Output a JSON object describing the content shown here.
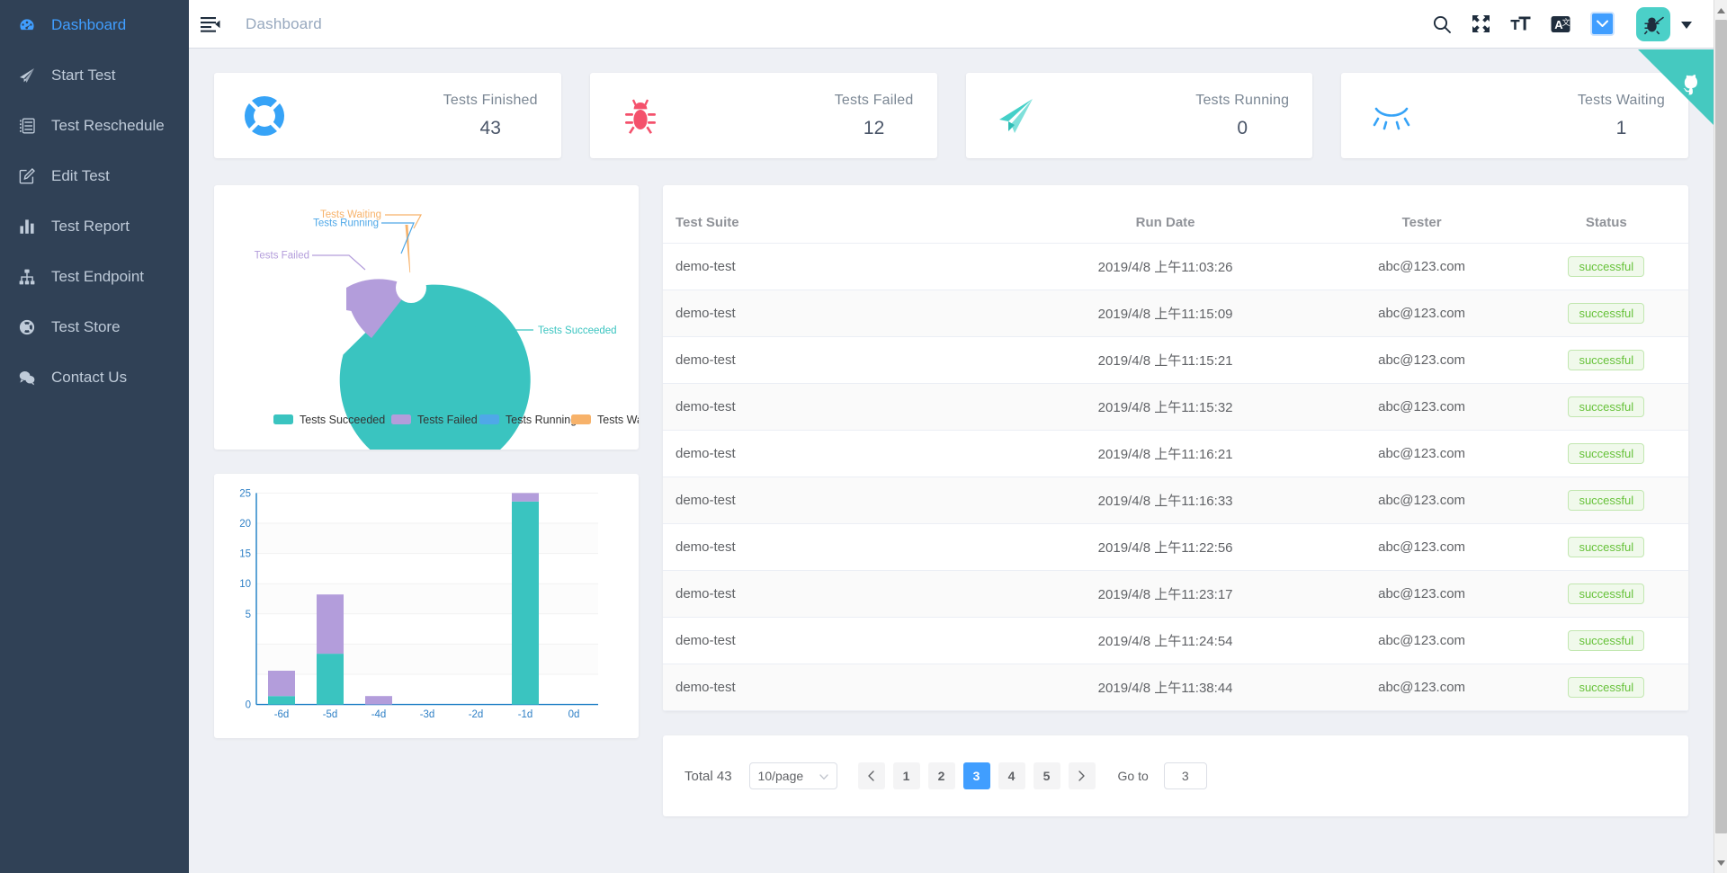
{
  "sidebar": {
    "items": [
      {
        "label": "Dashboard",
        "icon": "dashboard-icon",
        "active": true
      },
      {
        "label": "Start Test",
        "icon": "paper-plane-icon",
        "active": false
      },
      {
        "label": "Test Reschedule",
        "icon": "list-icon",
        "active": false
      },
      {
        "label": "Edit Test",
        "icon": "edit-square-icon",
        "active": false
      },
      {
        "label": "Test Report",
        "icon": "bar-chart-icon",
        "active": false
      },
      {
        "label": "Test Endpoint",
        "icon": "sitemap-icon",
        "active": false
      },
      {
        "label": "Test Store",
        "icon": "compass-icon",
        "active": false
      },
      {
        "label": "Contact Us",
        "icon": "chat-icon",
        "active": false
      }
    ]
  },
  "header": {
    "breadcrumb": "Dashboard",
    "hamburger_icon": "hamburger-collapse-icon",
    "icons": [
      {
        "name": "search-icon"
      },
      {
        "name": "fullscreen-icon"
      },
      {
        "name": "font-size-icon"
      },
      {
        "name": "translate-icon"
      },
      {
        "name": "chevron-down-button"
      }
    ],
    "avatar_icon": "bug-avatar-icon",
    "avatar_bg": "#4bd0c8",
    "caret_icon": "caret-down-icon",
    "ribbon_icon": "github-octocat-icon",
    "ribbon_color": "#45c9c0"
  },
  "stats": [
    {
      "label": "Tests Finished",
      "value": "43",
      "icon": "lifebuoy-icon",
      "color": "#36a3f7"
    },
    {
      "label": "Tests Failed",
      "value": "12",
      "icon": "bug-icon",
      "color": "#f4516c"
    },
    {
      "label": "Tests Running",
      "value": "0",
      "icon": "paper-plane-icon",
      "color": "#44d0c8"
    },
    {
      "label": "Tests Waiting",
      "value": "1",
      "icon": "eye-closed-icon",
      "color": "#36a3f7"
    }
  ],
  "chart_data": [
    {
      "type": "pie",
      "title": "",
      "variant": "doughnut-rose",
      "legend_position": "bottom",
      "labels": [
        "Tests Succeeded",
        "Tests Failed",
        "Tests Running",
        "Tests Waiting"
      ],
      "values": [
        43,
        12,
        0,
        1
      ],
      "colors": [
        "#3ac4c0",
        "#b39ddb",
        "#4fa8e8",
        "#f7b26a"
      ],
      "legend": [
        "Tests Succeeded",
        "Tests Failed",
        "Tests Running",
        "Tests Waiting"
      ],
      "annotations": [
        "Tests Waiting",
        "Tests Running",
        "Tests Failed",
        "Tests Succeeded"
      ]
    },
    {
      "type": "bar",
      "variant": "stacked",
      "title": "",
      "xlabel": "",
      "ylabel": "",
      "categories": [
        "-6d",
        "-5d",
        "-4d",
        "-3d",
        "-2d",
        "-1d",
        "0d"
      ],
      "yticks": [
        0,
        5,
        10,
        15,
        20,
        25
      ],
      "ylim": [
        0,
        25
      ],
      "grid": true,
      "series": [
        {
          "name": "Tests Succeeded",
          "color": "#3ac4c0",
          "values": [
            1,
            6,
            0,
            0,
            0,
            24,
            0
          ]
        },
        {
          "name": "Tests Failed",
          "color": "#b39ddb",
          "values": [
            3,
            7,
            1,
            0,
            0,
            1,
            0
          ]
        }
      ],
      "tick_color": "#2f80c6"
    }
  ],
  "table": {
    "columns": [
      "Test Suite",
      "Run Date",
      "Tester",
      "Status"
    ],
    "rows": [
      {
        "suite": "demo-test",
        "date": "2019/4/8 上午11:03:26",
        "tester": "abc@123.com",
        "status": "successful"
      },
      {
        "suite": "demo-test",
        "date": "2019/4/8 上午11:15:09",
        "tester": "abc@123.com",
        "status": "successful"
      },
      {
        "suite": "demo-test",
        "date": "2019/4/8 上午11:15:21",
        "tester": "abc@123.com",
        "status": "successful"
      },
      {
        "suite": "demo-test",
        "date": "2019/4/8 上午11:15:32",
        "tester": "abc@123.com",
        "status": "successful"
      },
      {
        "suite": "demo-test",
        "date": "2019/4/8 上午11:16:21",
        "tester": "abc@123.com",
        "status": "successful"
      },
      {
        "suite": "demo-test",
        "date": "2019/4/8 上午11:16:33",
        "tester": "abc@123.com",
        "status": "successful"
      },
      {
        "suite": "demo-test",
        "date": "2019/4/8 上午11:22:56",
        "tester": "abc@123.com",
        "status": "successful"
      },
      {
        "suite": "demo-test",
        "date": "2019/4/8 上午11:23:17",
        "tester": "abc@123.com",
        "status": "successful"
      },
      {
        "suite": "demo-test",
        "date": "2019/4/8 上午11:24:54",
        "tester": "abc@123.com",
        "status": "successful"
      },
      {
        "suite": "demo-test",
        "date": "2019/4/8 上午11:38:44",
        "tester": "abc@123.com",
        "status": "successful"
      }
    ]
  },
  "pagination": {
    "total_label": "Total 43",
    "page_size": "10/page",
    "prev_icon": "chevron-left-icon",
    "next_icon": "chevron-right-icon",
    "pages": [
      "1",
      "2",
      "3",
      "4",
      "5"
    ],
    "current_page": "3",
    "goto_label": "Go to",
    "goto_value": "3"
  }
}
